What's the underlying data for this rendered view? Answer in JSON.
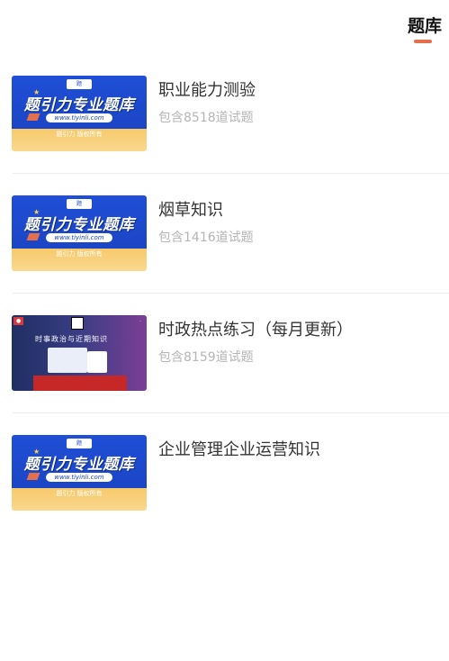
{
  "header": {
    "title": "题库"
  },
  "banner_text": {
    "headline": "题引力专业题库",
    "url": "www.tiyinli.com",
    "caption": "题引力 版权所有",
    "purple_head": "时事政治与近期知识"
  },
  "items": [
    {
      "title": "职业能力测验",
      "subtitle": "包含8518道试题",
      "thumb": "blue"
    },
    {
      "title": "烟草知识",
      "subtitle": "包含1416道试题",
      "thumb": "blue"
    },
    {
      "title": "时政热点练习（每月更新）",
      "subtitle": "包含8159道试题",
      "thumb": "purple"
    },
    {
      "title": "企业管理企业运营知识",
      "subtitle": "",
      "thumb": "blue"
    }
  ],
  "colors": {
    "accent": "#e2704d",
    "brand_blue": "#1b45c5"
  }
}
